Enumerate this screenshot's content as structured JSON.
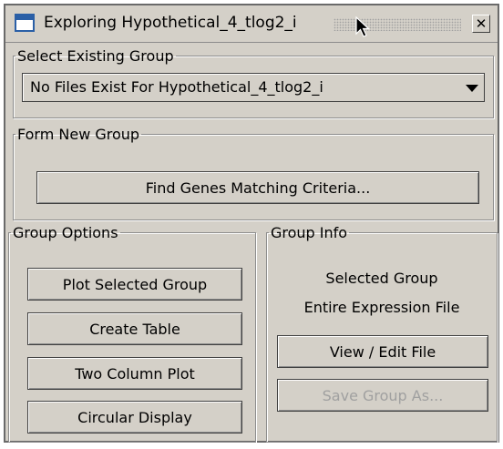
{
  "window": {
    "title": "Exploring Hypothetical_4_tlog2_i",
    "close_glyph": "✕",
    "icon": "app-window-icon"
  },
  "select_group": {
    "legend": "Select Existing Group",
    "selected": "No Files Exist For Hypothetical_4_tlog2_i"
  },
  "form_group": {
    "legend": "Form New Group",
    "find_label": "Find Genes Matching Criteria..."
  },
  "group_options": {
    "legend": "Group Options",
    "buttons": [
      "Plot Selected Group",
      "Create Table",
      "Two Column Plot",
      "Circular Display"
    ]
  },
  "group_info": {
    "legend": "Group Info",
    "heading": "Selected Group",
    "value": "Entire Expression File",
    "view_edit_label": "View / Edit File",
    "save_as_label": "Save Group As..."
  },
  "colors": {
    "panel": "#d4d0c8",
    "icon_blue": "#2a5fa6",
    "disabled_text": "#a0a0a0"
  }
}
